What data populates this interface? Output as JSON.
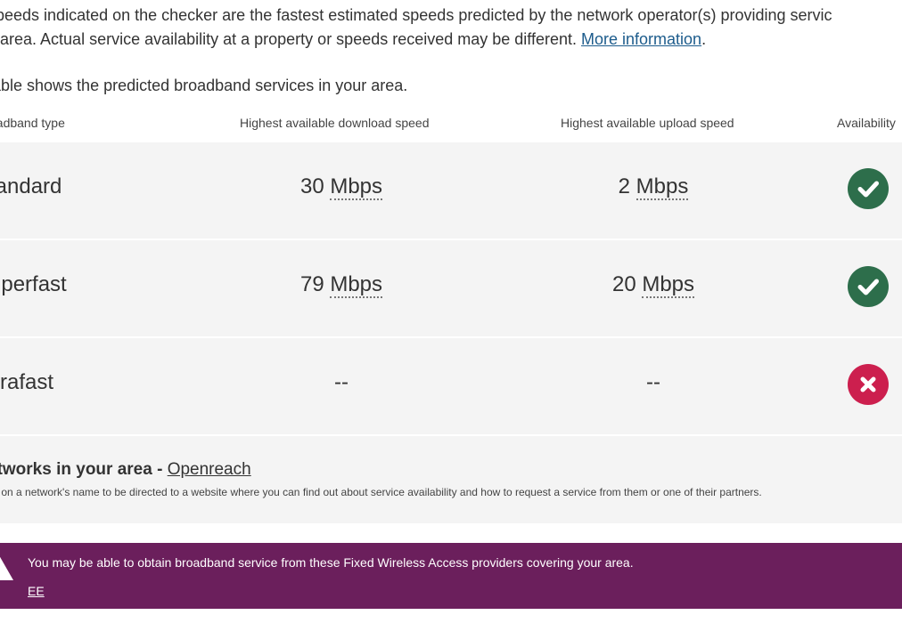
{
  "intro": {
    "text": "speeds indicated on the checker are the fastest estimated speeds predicted by the network operator(s) providing servic",
    "text2": "s area. Actual service availability at a property or speeds received may be different. ",
    "more_link": "More information",
    "after_link": "."
  },
  "lead": "table shows the predicted broadband services in your area.",
  "table": {
    "headers": {
      "type": "oadband type",
      "download": "Highest available download speed",
      "upload": "Highest available upload speed",
      "availability": "Availability"
    },
    "rows": [
      {
        "type": "tandard",
        "download_value": "30",
        "download_unit": "Mbps",
        "upload_value": "2",
        "upload_unit": "Mbps",
        "available": true
      },
      {
        "type": "uperfast",
        "download_value": "79",
        "download_unit": "Mbps",
        "upload_value": "20",
        "upload_unit": "Mbps",
        "available": true
      },
      {
        "type": "ltrafast",
        "download_value": "--",
        "download_unit": "",
        "upload_value": "--",
        "upload_unit": "",
        "available": false
      }
    ]
  },
  "networks": {
    "title": "etworks in your area - ",
    "link": "Openreach",
    "note": "ck on a network's name to be directed to a website where you can find out about service availability and how to request a service from them or one of their partners."
  },
  "banner": {
    "message": "You may be able to obtain broadband service from these Fixed Wireless Access providers covering your area.",
    "link": "EE"
  },
  "colors": {
    "available": "#2d6e4b",
    "unavailable": "#cc1f4e",
    "banner": "#6b1f5c",
    "link": "#1d5c8c"
  },
  "icons": {
    "available": "check-icon",
    "unavailable": "cross-icon",
    "banner": "warning-icon"
  }
}
